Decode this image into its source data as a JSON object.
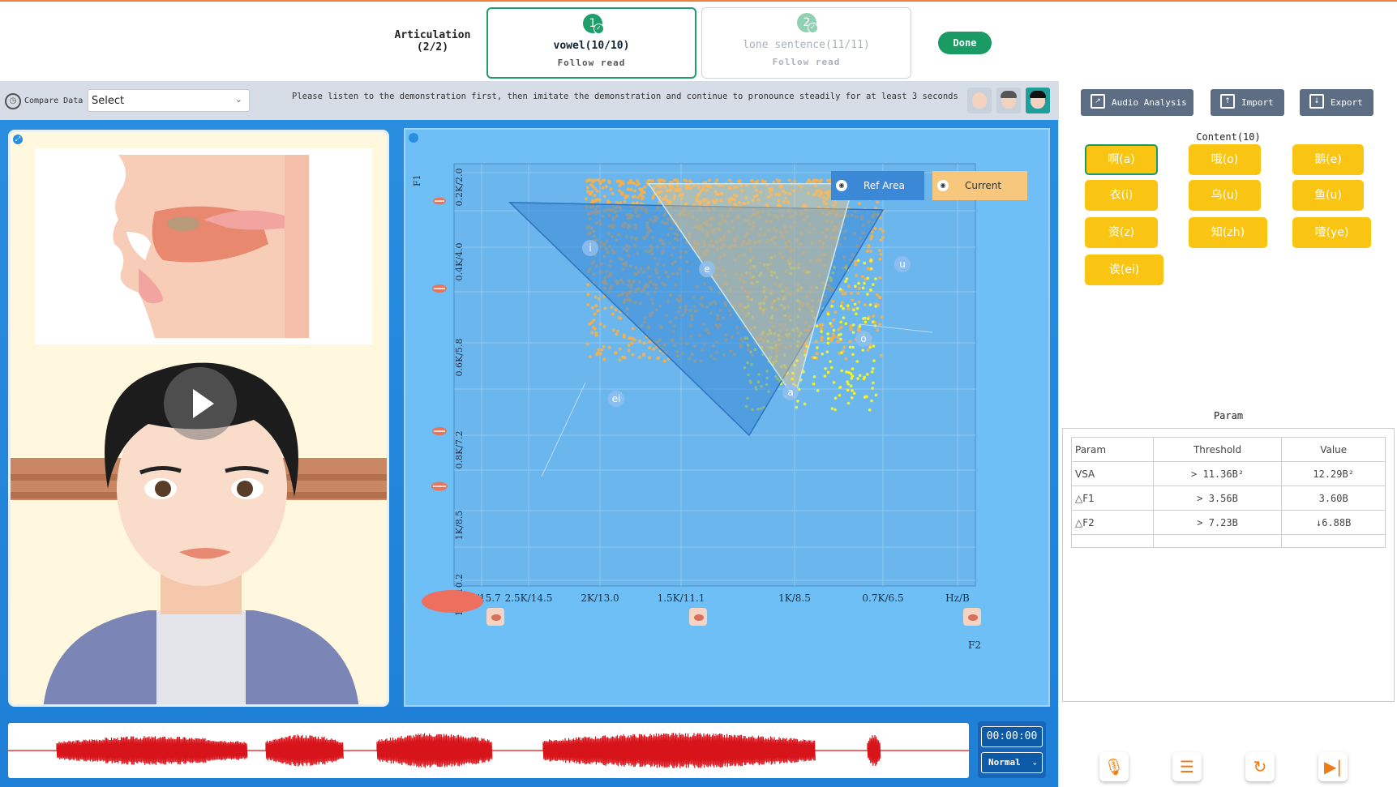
{
  "header": {
    "articulation_line1": "Articulation",
    "articulation_line2": "(2/2)",
    "steps": [
      {
        "num": "1",
        "title": "vowel(10/10)",
        "sub": "Follow read",
        "state": "active"
      },
      {
        "num": "2",
        "title": "lone sentence(11/11)",
        "sub": "Follow read",
        "state": "inactive"
      }
    ],
    "done_label": "Done",
    "accent": "#1a9b63"
  },
  "toolbar": {
    "compare_label": "Compare Data",
    "select_value": "Select",
    "instruction": "Please listen to the demonstration first, then imitate the demonstration and continue to pronounce steadily for at least 3 seconds"
  },
  "chart": {
    "y_axis_title": "F1",
    "x_axis_title": "F2",
    "y_ticks": [
      "0.2K/2.0",
      "0.4K/4.0",
      "0.6K/5.8",
      "0.8K/7.2",
      "1K/8.5",
      "1.3k/10.2"
    ],
    "x_ticks": [
      "3K/15.7",
      "2.5K/14.5",
      "2K/13.0",
      "1.5K/11.1",
      "1K/8.5",
      "0.7K/6.5",
      "Hz/B"
    ],
    "legend_ref": "Ref Area",
    "legend_current": "Current",
    "vowel_labels": [
      "ei",
      "a",
      "u",
      "o",
      "i",
      "e"
    ]
  },
  "chart_data": {
    "type": "scatter",
    "title": "",
    "xlabel": "F2",
    "ylabel": "F1",
    "x_scale": "reversed (Hz / Bark)",
    "series": [
      {
        "name": "Ref Area",
        "shape": "polygon",
        "points": [
          {
            "label": "i",
            "f2_hz": 2700,
            "f1_hz": 280
          },
          {
            "label": "u",
            "f2_hz": 700,
            "f1_hz": 300
          },
          {
            "label": "a",
            "f2_hz": 1200,
            "f1_hz": 800
          }
        ],
        "color": "#3b89d6"
      },
      {
        "name": "Current",
        "shape": "polygon",
        "points": [
          {
            "f2_hz": 1700,
            "f1_hz": 230
          },
          {
            "f2_hz": 800,
            "f1_hz": 230
          },
          {
            "f2_hz": 1000,
            "f1_hz": 720
          }
        ],
        "color": "#f7c77d"
      }
    ],
    "grid": true,
    "legend_position": "top-right"
  },
  "audio": {
    "time": "00:00:00",
    "speed": "Normal"
  },
  "sidebar": {
    "audio_analysis": "Audio Analysis",
    "import": "Import",
    "export": "Export",
    "content_title": "Content(10)",
    "chips": [
      "啊(a)",
      "哦(o)",
      "鹅(e)",
      "衣(i)",
      "乌(u)",
      "鱼(u)",
      "资(z)",
      "知(zh)",
      "噎(ye)",
      "诶(ei)"
    ],
    "param_title": "Param",
    "param_headers": [
      "Param",
      "Threshold",
      "Value"
    ],
    "param_rows": [
      [
        "VSA",
        "> 11.36B²",
        "12.29B²"
      ],
      [
        "△F1",
        "> 3.56B",
        "3.60B"
      ],
      [
        "△F2",
        "> 7.23B",
        "↓6.88B"
      ]
    ]
  }
}
